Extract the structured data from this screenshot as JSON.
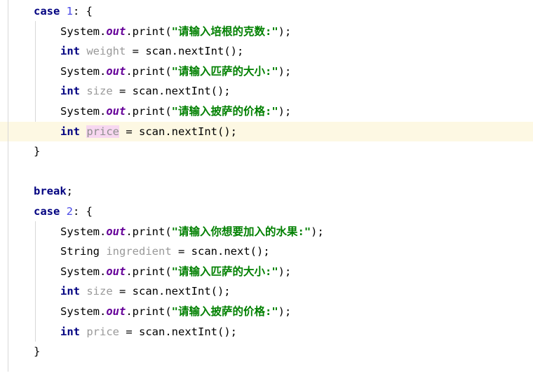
{
  "editor": {
    "language": "java",
    "background_color": "#ffffff",
    "highlight_line_color": "#fdf8e3",
    "gutter_rule_color": "#d8d8d8",
    "indent_guide_color": "#d8d8d8",
    "colors": {
      "keyword": "#000080",
      "number": "#4a4ae8",
      "string": "#008000",
      "static_field": "#660099",
      "local_variable": "#999999",
      "plain_text": "#000000",
      "occurrence_highlight": "#f7d7f0"
    }
  },
  "code": {
    "lines": [
      {
        "n": 1,
        "indent": 0,
        "highlighted": false,
        "tokens": [
          {
            "t": "case",
            "k": "kw"
          },
          {
            "t": " ",
            "k": "plain"
          },
          {
            "t": "1",
            "k": "num"
          },
          {
            "t": ": {",
            "k": "plain"
          }
        ]
      },
      {
        "n": 2,
        "indent": 1,
        "highlighted": false,
        "tokens": [
          {
            "t": "System.",
            "k": "plain"
          },
          {
            "t": "out",
            "k": "field"
          },
          {
            "t": ".print(",
            "k": "plain"
          },
          {
            "t": "\"请输入培根的克数:\"",
            "k": "str"
          },
          {
            "t": ");",
            "k": "plain"
          }
        ]
      },
      {
        "n": 3,
        "indent": 1,
        "highlighted": false,
        "tokens": [
          {
            "t": "int",
            "k": "kw"
          },
          {
            "t": " ",
            "k": "plain"
          },
          {
            "t": "weight",
            "k": "var"
          },
          {
            "t": " = scan.nextInt();",
            "k": "plain"
          }
        ]
      },
      {
        "n": 4,
        "indent": 1,
        "highlighted": false,
        "tokens": [
          {
            "t": "System.",
            "k": "plain"
          },
          {
            "t": "out",
            "k": "field"
          },
          {
            "t": ".print(",
            "k": "plain"
          },
          {
            "t": "\"请输入匹萨的大小:\"",
            "k": "str"
          },
          {
            "t": ");",
            "k": "plain"
          }
        ]
      },
      {
        "n": 5,
        "indent": 1,
        "highlighted": false,
        "tokens": [
          {
            "t": "int",
            "k": "kw"
          },
          {
            "t": " ",
            "k": "plain"
          },
          {
            "t": "size",
            "k": "var"
          },
          {
            "t": " = scan.nextInt();",
            "k": "plain"
          }
        ]
      },
      {
        "n": 6,
        "indent": 1,
        "highlighted": false,
        "tokens": [
          {
            "t": "System.",
            "k": "plain"
          },
          {
            "t": "out",
            "k": "field"
          },
          {
            "t": ".print(",
            "k": "plain"
          },
          {
            "t": "\"请输入披萨的价格:\"",
            "k": "str"
          },
          {
            "t": ");",
            "k": "plain"
          }
        ]
      },
      {
        "n": 7,
        "indent": 1,
        "highlighted": true,
        "tokens": [
          {
            "t": "int",
            "k": "kw"
          },
          {
            "t": " ",
            "k": "plain"
          },
          {
            "t": "price",
            "k": "var-hl"
          },
          {
            "t": " = scan.nextInt();",
            "k": "plain"
          }
        ]
      },
      {
        "n": 8,
        "indent": 0,
        "highlighted": false,
        "tokens": [
          {
            "t": "}",
            "k": "brace"
          }
        ]
      },
      {
        "n": 9,
        "indent": 0,
        "highlighted": false,
        "tokens": []
      },
      {
        "n": 10,
        "indent": 0,
        "highlighted": false,
        "tokens": [
          {
            "t": "break",
            "k": "kw"
          },
          {
            "t": ";",
            "k": "plain"
          }
        ]
      },
      {
        "n": 11,
        "indent": 0,
        "highlighted": false,
        "tokens": [
          {
            "t": "case",
            "k": "kw"
          },
          {
            "t": " ",
            "k": "plain"
          },
          {
            "t": "2",
            "k": "num"
          },
          {
            "t": ": {",
            "k": "plain"
          }
        ]
      },
      {
        "n": 12,
        "indent": 1,
        "highlighted": false,
        "tokens": [
          {
            "t": "System.",
            "k": "plain"
          },
          {
            "t": "out",
            "k": "field"
          },
          {
            "t": ".print(",
            "k": "plain"
          },
          {
            "t": "\"请输入你想要加入的水果:\"",
            "k": "str"
          },
          {
            "t": ");",
            "k": "plain"
          }
        ]
      },
      {
        "n": 13,
        "indent": 1,
        "highlighted": false,
        "tokens": [
          {
            "t": "String",
            "k": "plain"
          },
          {
            "t": " ",
            "k": "plain"
          },
          {
            "t": "ingredient",
            "k": "var"
          },
          {
            "t": " = scan.next();",
            "k": "plain"
          }
        ]
      },
      {
        "n": 14,
        "indent": 1,
        "highlighted": false,
        "tokens": [
          {
            "t": "System.",
            "k": "plain"
          },
          {
            "t": "out",
            "k": "field"
          },
          {
            "t": ".print(",
            "k": "plain"
          },
          {
            "t": "\"请输入匹萨的大小:\"",
            "k": "str"
          },
          {
            "t": ");",
            "k": "plain"
          }
        ]
      },
      {
        "n": 15,
        "indent": 1,
        "highlighted": false,
        "tokens": [
          {
            "t": "int",
            "k": "kw"
          },
          {
            "t": " ",
            "k": "plain"
          },
          {
            "t": "size",
            "k": "var"
          },
          {
            "t": " = scan.nextInt();",
            "k": "plain"
          }
        ]
      },
      {
        "n": 16,
        "indent": 1,
        "highlighted": false,
        "tokens": [
          {
            "t": "System.",
            "k": "plain"
          },
          {
            "t": "out",
            "k": "field"
          },
          {
            "t": ".print(",
            "k": "plain"
          },
          {
            "t": "\"请输入披萨的价格:\"",
            "k": "str"
          },
          {
            "t": ");",
            "k": "plain"
          }
        ]
      },
      {
        "n": 17,
        "indent": 1,
        "highlighted": false,
        "tokens": [
          {
            "t": "int",
            "k": "kw"
          },
          {
            "t": " ",
            "k": "plain"
          },
          {
            "t": "price",
            "k": "var"
          },
          {
            "t": " = scan.nextInt();",
            "k": "plain"
          }
        ]
      },
      {
        "n": 18,
        "indent": 0,
        "highlighted": false,
        "tokens": [
          {
            "t": "}",
            "k": "brace"
          }
        ]
      }
    ]
  }
}
